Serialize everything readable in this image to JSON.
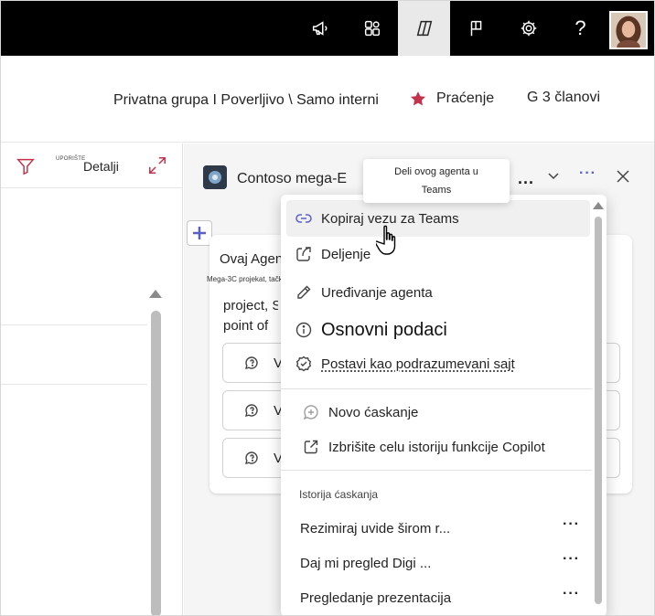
{
  "topbar": {
    "icons": [
      "megaphone-icon",
      "apps-icon",
      "copilot-icon",
      "flag-icon",
      "gear-icon",
      "help-icon"
    ],
    "help_glyph": "?"
  },
  "group": {
    "name": "Privatna grupa I Poverljivo \\ Samo interni",
    "follow_label": "Praćenje",
    "members_label": "G 3 članovi",
    "follow_color": "#c4314b"
  },
  "left_pane": {
    "details_small": "UPORIŠTE",
    "details_label": "Detalji",
    "accent": "#c4314b"
  },
  "agent_pane": {
    "title": "Contoso mega-E",
    "title_dots": "...",
    "more_glyph": "···"
  },
  "card": {
    "title": "Ovaj Agen",
    "caption": "Mega-3C projekat, tačka",
    "text_line1": "project, S",
    "text_line2": "point of",
    "prompts": [
      "V",
      "V",
      "V"
    ]
  },
  "tooltip": {
    "text_line1": "Deli ovog agenta u",
    "text_line2": "Teams"
  },
  "menu": {
    "items": [
      {
        "label": "Kopiraj vezu za Teams",
        "icon": "link-icon"
      },
      {
        "label": "Deljenje",
        "icon": "share-icon"
      },
      {
        "label": "Uređivanje agenta",
        "icon": "pencil-icon"
      },
      {
        "label": "Osnovni podaci",
        "icon": "info-icon"
      },
      {
        "label": "Postavi kao podrazumevani sajt",
        "icon": "badge-check-icon"
      }
    ],
    "actions": [
      {
        "label": "Novo ćaskanje",
        "icon": "new-chat-icon"
      },
      {
        "label": "Izbrišite celu istoriju funkcije Copilot",
        "icon": "open-external-icon"
      }
    ],
    "history_title": "Istorija ćaskanja",
    "history": [
      {
        "label": "Rezimiraj uvide širom r..."
      },
      {
        "label": "Daj mi pregled Digi ..."
      },
      {
        "label": "Pregledanje prezentacija"
      }
    ],
    "dots": "···"
  }
}
